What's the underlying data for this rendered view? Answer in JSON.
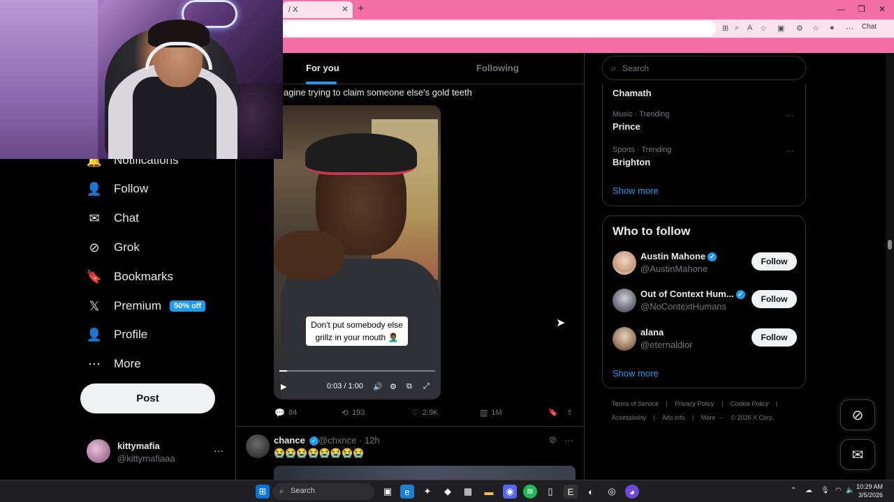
{
  "browser": {
    "tab_title": "/ X",
    "tab_close": "✕",
    "new_tab": "+",
    "chat_label": "Chat",
    "window_controls": [
      "—",
      "❐",
      "✕"
    ]
  },
  "colors": {
    "accent": "#1d9bf0",
    "chrome_pink": "#f36fa6",
    "background": "#000000",
    "muted_text": "#71767b"
  },
  "nav": {
    "items": [
      {
        "label": "Notifications",
        "icon": "bell-icon",
        "glyph": "🔔"
      },
      {
        "label": "Follow",
        "icon": "follow-icon",
        "glyph": "👤"
      },
      {
        "label": "Chat",
        "icon": "mail-icon",
        "glyph": "✉"
      },
      {
        "label": "Grok",
        "icon": "grok-icon",
        "glyph": "⊘"
      },
      {
        "label": "Bookmarks",
        "icon": "bookmark-icon",
        "glyph": "🔖"
      },
      {
        "label": "Premium",
        "icon": "x-logo-icon",
        "glyph": "𝕏",
        "badge": "50% off"
      },
      {
        "label": "Profile",
        "icon": "person-icon",
        "glyph": "👤"
      },
      {
        "label": "More",
        "icon": "more-circle-icon",
        "glyph": "⋯"
      }
    ],
    "post_label": "Post",
    "account": {
      "name": "kittymafia",
      "handle": "@kittymafiaaa",
      "menu": "···"
    }
  },
  "feed": {
    "tabs": [
      {
        "label": "For you",
        "active": true
      },
      {
        "label": "Following",
        "active": false
      }
    ],
    "tweet1": {
      "text": "agine trying to claim someone else's gold teeth",
      "video": {
        "caption": "Don't put somebody else grillz in your mouth 🤦🏾‍♂️",
        "time": "0:03 / 1:00",
        "progress": 0.05
      },
      "stats": {
        "replies": "84",
        "reposts": "193",
        "likes": "2.9K",
        "views": "1M"
      }
    },
    "tweet2": {
      "name": "chance",
      "handle": "@chxnce · 12h",
      "text": "😭😭😭😭😭😭😭😭",
      "more": "···"
    }
  },
  "sidebar": {
    "search_placeholder": "Search",
    "trends": [
      {
        "category": "",
        "title": "Chamath"
      },
      {
        "category": "Music · Trending",
        "title": "Prince"
      },
      {
        "category": "Sports · Trending",
        "title": "Brighton"
      }
    ],
    "trends_show_more": "Show more",
    "who_to_follow_title": "Who to follow",
    "who_to_follow": [
      {
        "name": "Austin Mahone",
        "handle": "@AustinMahone",
        "verified": true,
        "button": "Follow"
      },
      {
        "name": "Out of Context Hum...",
        "handle": "@NoContextHumans",
        "verified": true,
        "button": "Follow"
      },
      {
        "name": "alana",
        "handle": "@eternaldior",
        "verified": false,
        "button": "Follow"
      }
    ],
    "wtf_show_more": "Show more",
    "footer_line1": [
      "Terms of Service",
      "|",
      "Privacy Policy",
      "|",
      "Cookie Policy",
      "|"
    ],
    "footer_line2": [
      "Accessibility",
      "|",
      "Ads info",
      "|",
      "More ···",
      "© 2026 X Corp."
    ]
  },
  "taskbar": {
    "search_label": "Search",
    "time": "10:29 AM",
    "date": "3/5/2026"
  }
}
